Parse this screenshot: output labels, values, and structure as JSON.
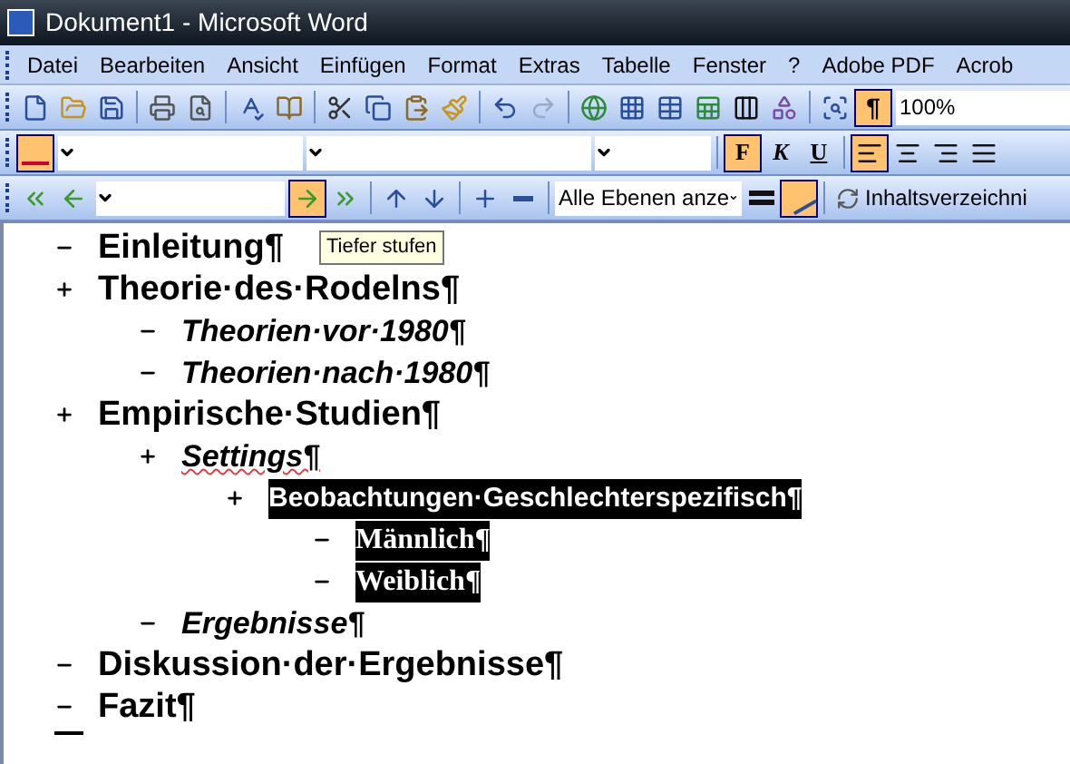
{
  "window": {
    "title": "Dokument1 - Microsoft Word"
  },
  "menu": [
    "Datei",
    "Bearbeiten",
    "Ansicht",
    "Einfügen",
    "Format",
    "Extras",
    "Tabelle",
    "Fenster",
    "?",
    "Adobe PDF",
    "Acrob"
  ],
  "standard_toolbar": {
    "show_marks": {
      "label": "¶",
      "on": true
    },
    "zoom": "100%"
  },
  "formatting_toolbar": {
    "styles_pane": {
      "on": true
    },
    "font_buttons": [
      {
        "label": "F",
        "on": true
      },
      {
        "label": "K",
        "on": false
      },
      {
        "label": "U",
        "on": false
      }
    ],
    "alignments": [
      {
        "selected": true
      },
      {
        "selected": false
      },
      {
        "selected": false
      },
      {
        "selected": false
      }
    ]
  },
  "outlining_toolbar": {
    "demote": {
      "on": true
    },
    "show_level": "Alle Ebenen anze",
    "show_formatting": {
      "on": true
    },
    "toc_button": "Inhaltsverzeichni"
  },
  "tooltip": "Tiefer stufen",
  "outline": [
    {
      "text": "Einleitung¶",
      "expandable": false,
      "selected": false,
      "misspelled": false
    },
    {
      "text": "Theorie·des·Rodelns¶",
      "expandable": true,
      "selected": false,
      "misspelled": false,
      "children": [
        {
          "text": "Theorien·vor·1980¶",
          "expandable": false,
          "selected": false,
          "misspelled": false
        },
        {
          "text": "Theorien·nach·1980¶",
          "expandable": false,
          "selected": false,
          "misspelled": false
        }
      ]
    },
    {
      "text": "Empirische·Studien¶",
      "expandable": true,
      "selected": false,
      "misspelled": false,
      "children": [
        {
          "text": "Settings¶",
          "expandable": true,
          "selected": false,
          "misspelled": true,
          "children": [
            {
              "text": "Beobachtungen·Geschlechterspezifisch¶",
              "expandable": true,
              "selected": true,
              "misspelled": false,
              "children": [
                {
                  "text": "Männlich¶",
                  "expandable": false,
                  "selected": true,
                  "misspelled": false
                },
                {
                  "text": "Weiblich¶",
                  "expandable": false,
                  "selected": true,
                  "misspelled": false
                }
              ]
            }
          ]
        },
        {
          "text": "Ergebnisse¶",
          "expandable": false,
          "selected": false,
          "misspelled": false
        }
      ]
    },
    {
      "text": "Diskussion·der·Ergebnisse¶",
      "expandable": false,
      "selected": false,
      "misspelled": false
    },
    {
      "text": "Fazit¶",
      "expandable": false,
      "selected": false,
      "misspelled": false
    }
  ]
}
